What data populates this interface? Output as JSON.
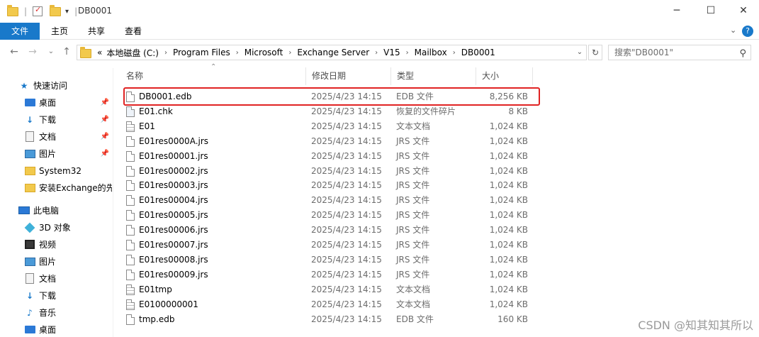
{
  "window": {
    "title": "DB0001",
    "minimize": "─",
    "maximize": "☐",
    "close": "✕"
  },
  "ribbon": {
    "tabs": [
      "文件",
      "主页",
      "共享",
      "查看"
    ],
    "collapse": "⌄",
    "help": "?"
  },
  "address": {
    "overflow": "«",
    "crumbs": [
      "本地磁盘 (C:)",
      "Program Files",
      "Microsoft",
      "Exchange Server",
      "V15",
      "Mailbox",
      "DB0001"
    ],
    "search_placeholder": "搜索\"DB0001\""
  },
  "sidebar": {
    "items": [
      {
        "label": "快速访问",
        "icon": "star-icon"
      },
      {
        "label": "桌面",
        "icon": "desktop-icon",
        "pinned": true
      },
      {
        "label": "下载",
        "icon": "download-icon",
        "pinned": true
      },
      {
        "label": "文档",
        "icon": "document-icon",
        "pinned": true
      },
      {
        "label": "图片",
        "icon": "pictures-icon",
        "pinned": true
      },
      {
        "label": "System32",
        "icon": "folder-icon"
      },
      {
        "label": "安装Exchange的先",
        "icon": "folder-icon"
      },
      {
        "label": "此电脑",
        "icon": "computer-icon"
      },
      {
        "label": "3D 对象",
        "icon": "3d-objects-icon"
      },
      {
        "label": "视频",
        "icon": "video-icon"
      },
      {
        "label": "图片",
        "icon": "pictures-icon"
      },
      {
        "label": "文档",
        "icon": "document-icon"
      },
      {
        "label": "下载",
        "icon": "download-icon"
      },
      {
        "label": "音乐",
        "icon": "music-icon"
      },
      {
        "label": "桌面",
        "icon": "desktop-icon"
      }
    ]
  },
  "columns": {
    "name": "名称",
    "date": "修改日期",
    "type": "类型",
    "size": "大小"
  },
  "files": [
    {
      "name": "DB0001.edb",
      "date": "2025/4/23 14:15",
      "type": "EDB 文件",
      "size": "8,256 KB",
      "icon": "file-icon"
    },
    {
      "name": "E01.chk",
      "date": "2025/4/23 14:15",
      "type": "恢复的文件碎片",
      "size": "8 KB",
      "icon": "chk-file-icon"
    },
    {
      "name": "E01",
      "date": "2025/4/23 14:15",
      "type": "文本文档",
      "size": "1,024 KB",
      "icon": "text-file-icon"
    },
    {
      "name": "E01res0000A.jrs",
      "date": "2025/4/23 14:15",
      "type": "JRS 文件",
      "size": "1,024 KB",
      "icon": "file-icon"
    },
    {
      "name": "E01res00001.jrs",
      "date": "2025/4/23 14:15",
      "type": "JRS 文件",
      "size": "1,024 KB",
      "icon": "file-icon"
    },
    {
      "name": "E01res00002.jrs",
      "date": "2025/4/23 14:15",
      "type": "JRS 文件",
      "size": "1,024 KB",
      "icon": "file-icon"
    },
    {
      "name": "E01res00003.jrs",
      "date": "2025/4/23 14:15",
      "type": "JRS 文件",
      "size": "1,024 KB",
      "icon": "file-icon"
    },
    {
      "name": "E01res00004.jrs",
      "date": "2025/4/23 14:15",
      "type": "JRS 文件",
      "size": "1,024 KB",
      "icon": "file-icon"
    },
    {
      "name": "E01res00005.jrs",
      "date": "2025/4/23 14:15",
      "type": "JRS 文件",
      "size": "1,024 KB",
      "icon": "file-icon"
    },
    {
      "name": "E01res00006.jrs",
      "date": "2025/4/23 14:15",
      "type": "JRS 文件",
      "size": "1,024 KB",
      "icon": "file-icon"
    },
    {
      "name": "E01res00007.jrs",
      "date": "2025/4/23 14:15",
      "type": "JRS 文件",
      "size": "1,024 KB",
      "icon": "file-icon"
    },
    {
      "name": "E01res00008.jrs",
      "date": "2025/4/23 14:15",
      "type": "JRS 文件",
      "size": "1,024 KB",
      "icon": "file-icon"
    },
    {
      "name": "E01res00009.jrs",
      "date": "2025/4/23 14:15",
      "type": "JRS 文件",
      "size": "1,024 KB",
      "icon": "file-icon"
    },
    {
      "name": "E01tmp",
      "date": "2025/4/23 14:15",
      "type": "文本文档",
      "size": "1,024 KB",
      "icon": "text-file-icon"
    },
    {
      "name": "E0100000001",
      "date": "2025/4/23 14:15",
      "type": "文本文档",
      "size": "1,024 KB",
      "icon": "text-file-icon"
    },
    {
      "name": "tmp.edb",
      "date": "2025/4/23 14:15",
      "type": "EDB 文件",
      "size": "160 KB",
      "icon": "file-icon"
    }
  ],
  "watermark": "CSDN @知其知其所以",
  "colors": {
    "accent": "#1979ca",
    "highlight": "#e02323"
  }
}
